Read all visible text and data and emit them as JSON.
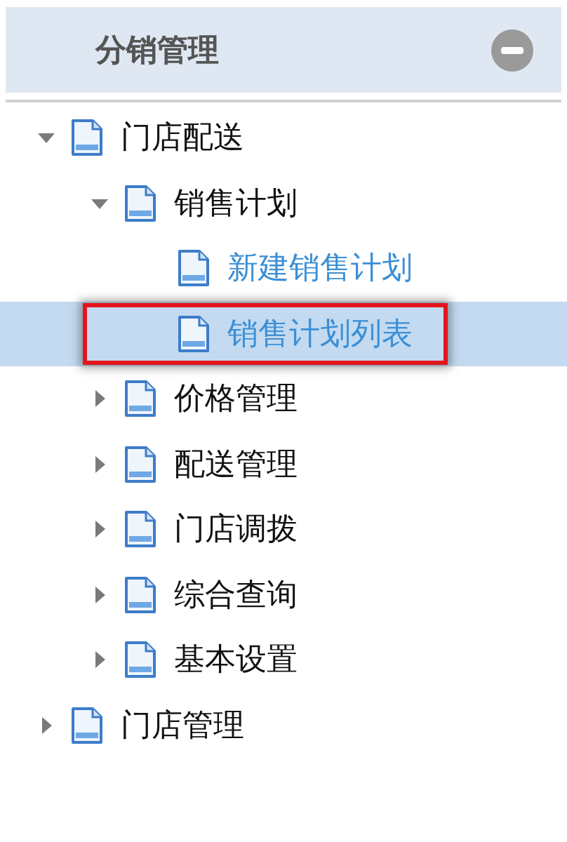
{
  "panel": {
    "title": "分销管理",
    "collapsed": false
  },
  "tree": [
    {
      "label": "门店配送",
      "kind": "folder",
      "expanded": true,
      "selected": false,
      "children": [
        {
          "label": "销售计划",
          "kind": "folder",
          "expanded": true,
          "selected": false,
          "children": [
            {
              "label": "新建销售计划",
              "kind": "link",
              "selected": false,
              "highlighted": false
            },
            {
              "label": "销售计划列表",
              "kind": "link",
              "selected": true,
              "highlighted": true
            }
          ]
        },
        {
          "label": "价格管理",
          "kind": "folder",
          "expanded": false,
          "selected": false
        },
        {
          "label": "配送管理",
          "kind": "folder",
          "expanded": false,
          "selected": false
        },
        {
          "label": "门店调拨",
          "kind": "folder",
          "expanded": false,
          "selected": false
        },
        {
          "label": "综合查询",
          "kind": "folder",
          "expanded": false,
          "selected": false
        },
        {
          "label": "基本设置",
          "kind": "folder",
          "expanded": false,
          "selected": false
        }
      ]
    },
    {
      "label": "门店管理",
      "kind": "folder",
      "expanded": false,
      "selected": false
    }
  ]
}
